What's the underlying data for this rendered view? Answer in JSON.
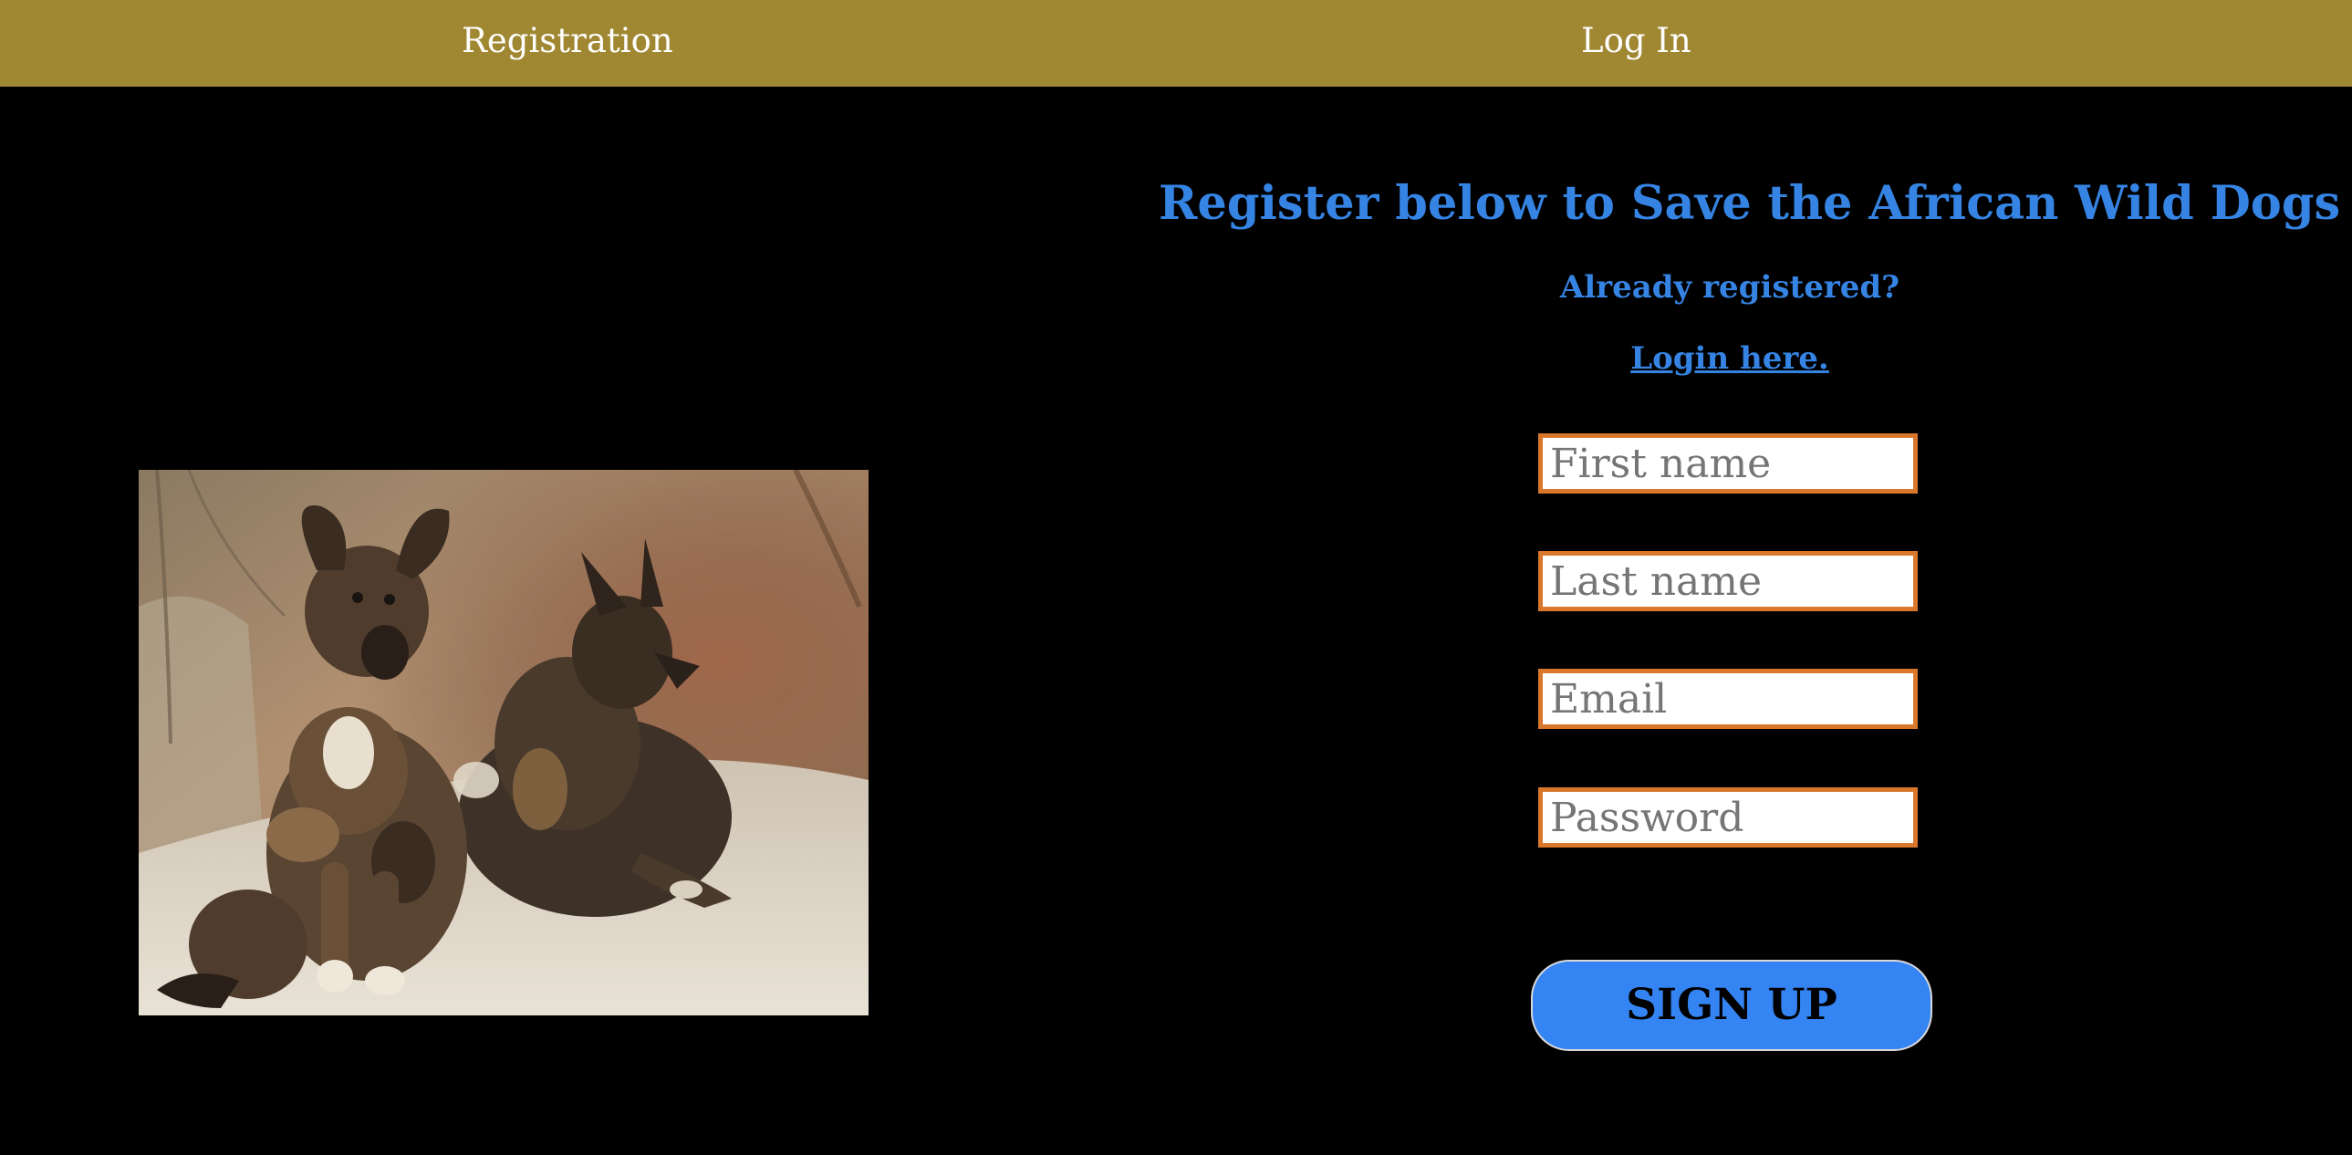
{
  "nav": {
    "registration_label": "Registration",
    "login_label": "Log In",
    "background_color": "#a08732"
  },
  "image": {
    "alt": "Two African wild dog pups sitting on sand"
  },
  "form": {
    "heading": "Register below to Save the African Wild Dogs",
    "already_registered": "Already registered?",
    "login_link": "Login here.",
    "fields": {
      "first_name": {
        "placeholder": "First name",
        "value": ""
      },
      "last_name": {
        "placeholder": "Last name",
        "value": ""
      },
      "email": {
        "placeholder": "Email",
        "value": ""
      },
      "password": {
        "placeholder": "Password",
        "value": ""
      }
    },
    "submit_label": "SIGN UP",
    "accent_color": "#3584e4",
    "field_border_color": "#d9782d"
  }
}
